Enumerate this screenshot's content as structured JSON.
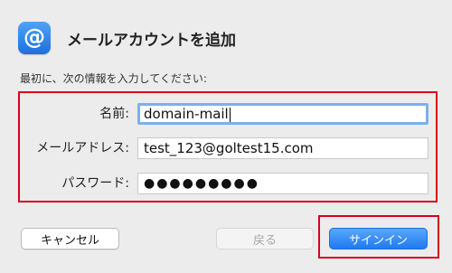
{
  "header": {
    "icon_glyph": "@",
    "title": "メールアカウントを追加"
  },
  "subtitle": "最初に、次の情報を入力してください:",
  "form": {
    "name_label": "名前:",
    "name_value": "domain-mail",
    "email_label": "メールアドレス:",
    "email_value": "test_123@goltest15.com",
    "password_label": "パスワード:",
    "password_mask": "●●●●●●●●●"
  },
  "buttons": {
    "cancel": "キャンセル",
    "back": "戻る",
    "signin": "サインイン"
  },
  "colors": {
    "highlight": "#d9001b",
    "accent": "#1f7af0"
  }
}
